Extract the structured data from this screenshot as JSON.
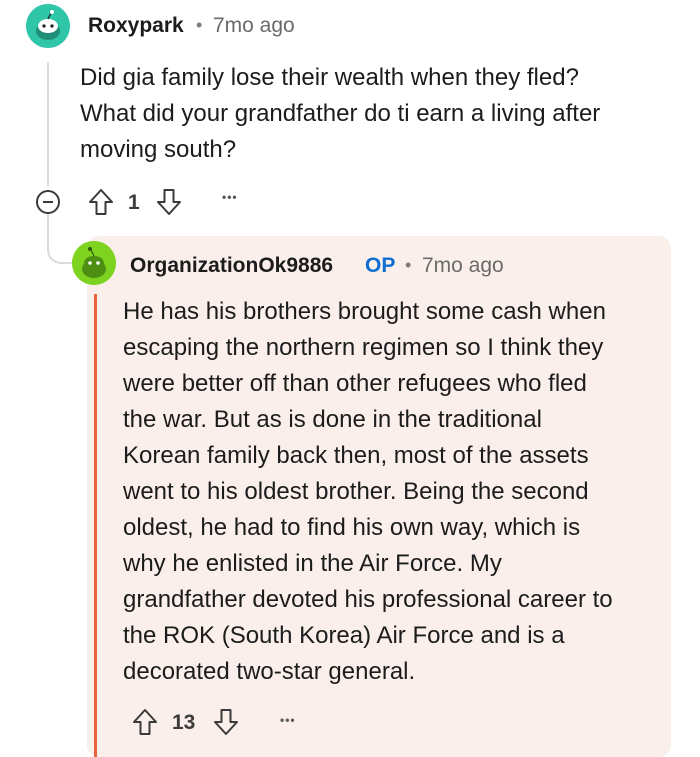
{
  "comment1": {
    "username": "Roxypark",
    "separator": "•",
    "time": "7mo ago",
    "lines": [
      "Did gia family lose their wealth when they fled?",
      "What did your grandfather do ti earn a living after",
      "moving south?"
    ],
    "votes": "1",
    "more": "•••"
  },
  "comment2": {
    "username": "OrganizationOk9886",
    "op_badge": "OP",
    "separator": "•",
    "time": "7mo ago",
    "lines": [
      "He has his brothers brought some cash when",
      "escaping the northern regimen so I think they",
      "were better off than other refugees who fled",
      "the war. But as is done in the traditional",
      "Korean family back then, most of the assets",
      "went to his oldest brother. Being the second",
      "oldest, he had to find his own way, which is",
      "why he enlisted in the Air Force. My",
      "grandfather devoted his professional career to",
      "the ROK (South Korea) Air Force and is a",
      "decorated two-star general."
    ],
    "votes": "13",
    "more": "•••"
  },
  "colors": {
    "avatar1": "#2fc6a8",
    "avatar2": "#7ed321",
    "op_blue": "#0f6fd1",
    "highlight_bg": "#fbefeb",
    "op_bar": "#e8623a"
  }
}
